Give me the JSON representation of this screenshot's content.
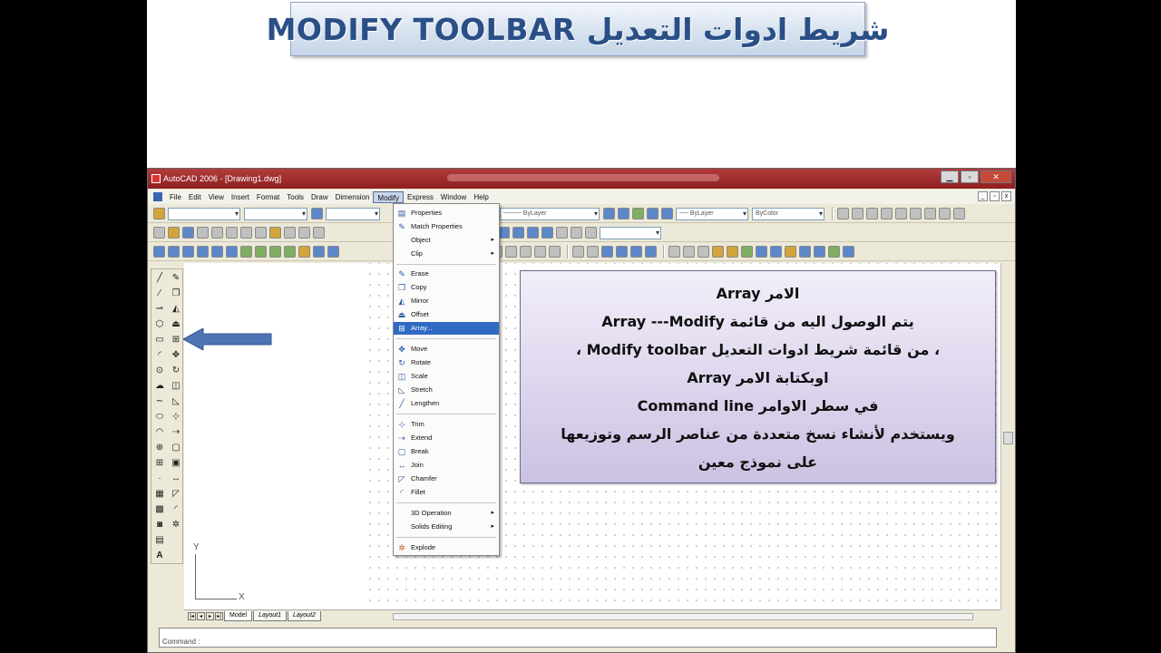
{
  "slide": {
    "title": "MODIFY TOOLBAR شريط ادوات التعديل"
  },
  "window": {
    "title": "AutoCAD 2006 - [Drawing1.dwg]"
  },
  "menubar": {
    "items": [
      "File",
      "Edit",
      "View",
      "Insert",
      "Format",
      "Tools",
      "Draw",
      "Dimension",
      "Modify",
      "Express",
      "Window",
      "Help"
    ],
    "open_item": "Modify"
  },
  "toolbar": {
    "linetype": "ByLayer",
    "lineweight": "ByLayer",
    "color": "ByColor"
  },
  "modify_menu": {
    "items": [
      {
        "label": "Properties",
        "icon": "properties-icon"
      },
      {
        "label": "Match Properties",
        "icon": "match-properties-icon"
      },
      {
        "label": "Object",
        "icon": "",
        "submenu": true
      },
      {
        "label": "Clip",
        "icon": "",
        "submenu": true
      },
      {
        "label": "Erase",
        "icon": "erase-icon"
      },
      {
        "label": "Copy",
        "icon": "copy-icon"
      },
      {
        "label": "Mirror",
        "icon": "mirror-icon"
      },
      {
        "label": "Offset",
        "icon": "offset-icon"
      },
      {
        "label": "Array...",
        "icon": "array-icon",
        "highlighted": true
      },
      {
        "label": "Move",
        "icon": "move-icon"
      },
      {
        "label": "Rotate",
        "icon": "rotate-icon"
      },
      {
        "label": "Scale",
        "icon": "scale-icon"
      },
      {
        "label": "Stretch",
        "icon": "stretch-icon"
      },
      {
        "label": "Lengthen",
        "icon": "lengthen-icon"
      },
      {
        "label": "Trim",
        "icon": "trim-icon"
      },
      {
        "label": "Extend",
        "icon": "extend-icon"
      },
      {
        "label": "Break",
        "icon": "break-icon"
      },
      {
        "label": "Join",
        "icon": "join-icon"
      },
      {
        "label": "Chamfer",
        "icon": "chamfer-icon"
      },
      {
        "label": "Fillet",
        "icon": "fillet-icon"
      },
      {
        "label": "3D Operation",
        "icon": "",
        "submenu": true
      },
      {
        "label": "Solids Editing",
        "icon": "",
        "submenu": true
      },
      {
        "label": "Explode",
        "icon": "explode-icon"
      }
    ]
  },
  "callout": {
    "lines": [
      "الامر Array",
      "يتم الوصول اليه من قائمة  Array ---Modify",
      "، من قائمة شريط ادوات التعديل  Modify toolbar ،",
      "اوبكتابة الامر Array",
      "في سطر الاوامر  Command line",
      "ويستخدم لأنشاء نسخ متعددة من عناصر الرسم وتوزيعها",
      "على نموذج معين"
    ]
  },
  "drawing": {
    "ucs_x": "X",
    "ucs_y": "Y",
    "tabs": [
      "Model",
      "Layout1",
      "Layout2"
    ]
  },
  "command_line": {
    "prompt": "Command :"
  },
  "colors": {
    "title_text": "#2a4f86",
    "menu_highlight": "#316ac5",
    "callout_fill": "#ccc1e3",
    "arrow_fill": "#4f74b3"
  }
}
